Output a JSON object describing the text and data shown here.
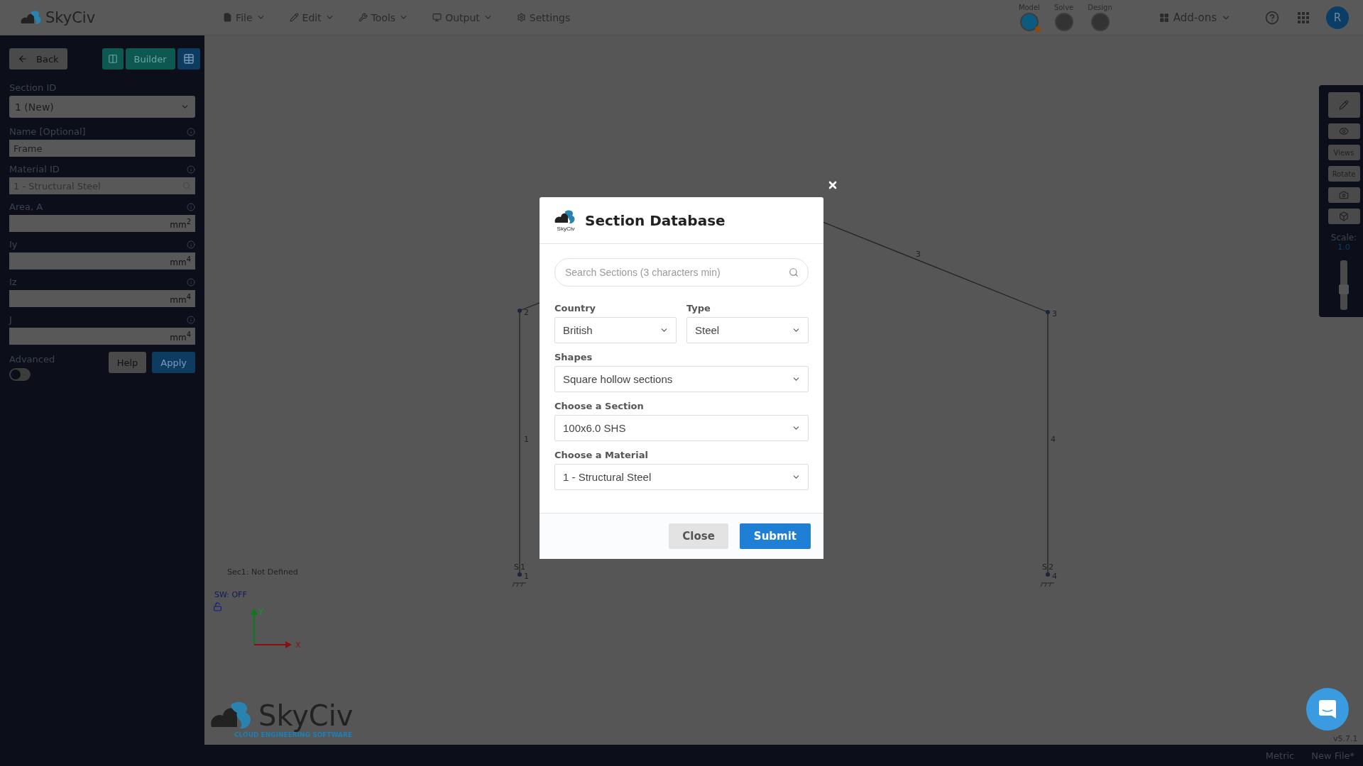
{
  "top_bar": {
    "logo": "SkyCiv",
    "menus": [
      {
        "label": "File"
      },
      {
        "label": "Edit"
      },
      {
        "label": "Tools"
      },
      {
        "label": "Output"
      }
    ],
    "settings": "Settings",
    "steps": [
      {
        "label": "Model",
        "selected": true
      },
      {
        "label": "Solve",
        "selected": false
      },
      {
        "label": "Design",
        "selected": false
      }
    ],
    "addons": "Add-ons",
    "avatar": "R"
  },
  "sidebar": {
    "back": "Back",
    "builder": "Builder",
    "section_id": {
      "label": "Section ID",
      "value": "1 (New)"
    },
    "fields": [
      {
        "label": "Name [Optional]",
        "kind": "text",
        "value": "Frame"
      },
      {
        "label": "Material ID",
        "kind": "search",
        "value": "1 - Structural Steel"
      },
      {
        "label": "Area, A",
        "kind": "unit",
        "unit": "mm$^{2}$"
      },
      {
        "label": "Iy",
        "kind": "unit",
        "unit": "mm$^{4}$"
      },
      {
        "label": "Iz",
        "kind": "unit",
        "unit": "mm$^{4}$"
      },
      {
        "label": "J",
        "kind": "unit",
        "unit": "mm$^{4}$"
      }
    ],
    "advanced": {
      "label": "Advanced",
      "on": false
    },
    "help": "Help",
    "apply": "Apply"
  },
  "canvas": {
    "status": "Sec1: Not Defined",
    "self_weight": "SW: OFF",
    "axes": {
      "x": "X",
      "y": "Y"
    },
    "nodes": [
      {
        "label": "2"
      },
      {
        "label": "3"
      },
      {
        "label": "1",
        "support": "S1"
      },
      {
        "label": "4",
        "support": "S2"
      }
    ],
    "members": [
      {
        "label": "1"
      },
      {
        "label": "3"
      },
      {
        "label": "4"
      }
    ],
    "logo": {
      "name": "SkyCiv",
      "tagline": "CLOUD ENGINEERING SOFTWARE"
    },
    "version": "v5.7.1"
  },
  "toolbar": {
    "buttons": [
      {
        "kind": "icon"
      },
      {
        "kind": "icon"
      },
      {
        "kind": "text",
        "label": "Views"
      },
      {
        "kind": "text",
        "label": "Rotate"
      },
      {
        "kind": "icon"
      },
      {
        "kind": "icon"
      }
    ],
    "scale_label": "Scale:",
    "scale_value": "1.0",
    "level": 0.4
  },
  "dialog": {
    "title": "Section Database",
    "logo": "SkyCiv",
    "search": {
      "placeholder": "Search Sections (3 characters min)"
    },
    "selects": [
      {
        "label": "Country",
        "value": "British"
      },
      {
        "label": "Type",
        "value": "Steel"
      },
      {
        "label": "Shapes",
        "value": "Square hollow sections"
      },
      {
        "label": "Choose a Section",
        "value": "100x6.0 SHS"
      },
      {
        "label": "Choose a Material",
        "value": "1 - Structural Steel"
      }
    ],
    "buttons": [
      {
        "label": "Close",
        "kind": "secondary"
      },
      {
        "label": "Submit",
        "kind": "primary"
      }
    ]
  },
  "status_bar": {
    "items": [
      "Metric",
      "New File*"
    ]
  }
}
